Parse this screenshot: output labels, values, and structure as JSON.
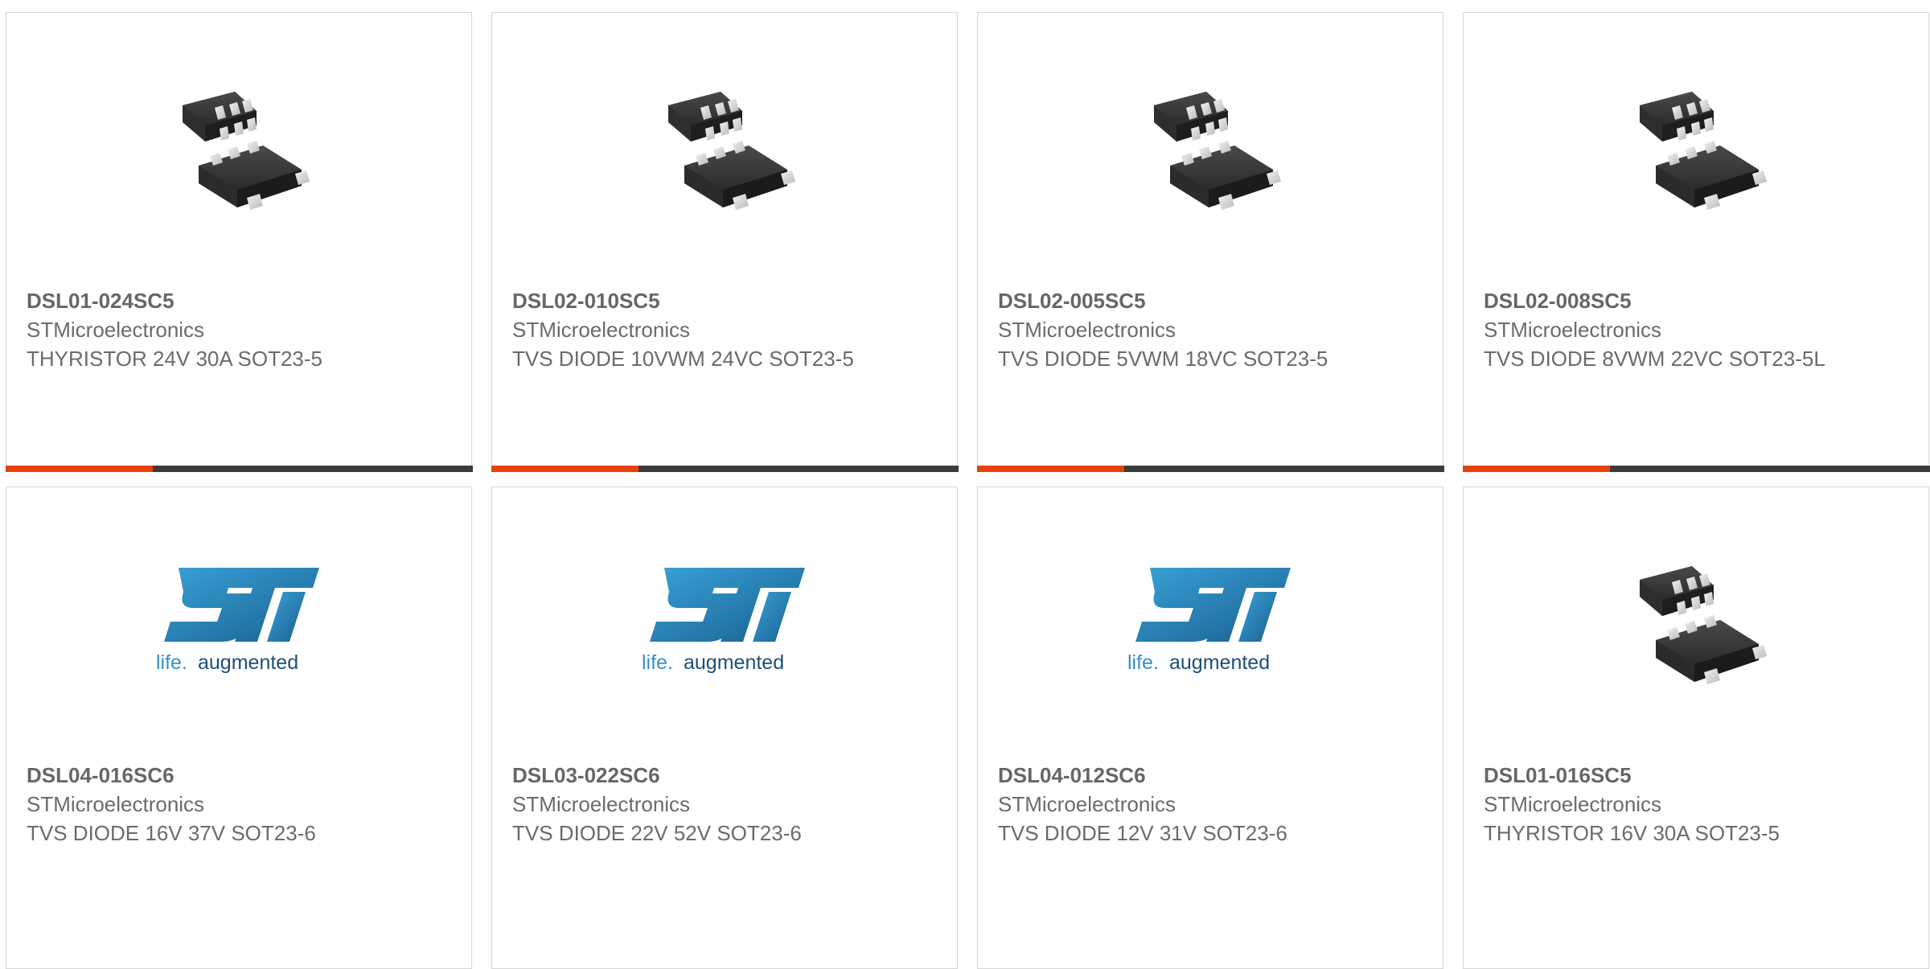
{
  "colors": {
    "accent": "#e8410f",
    "bar_track": "#3b3b3b",
    "border": "#d6d6d6",
    "text": "#6b6b6b",
    "st_logo_blue": "#1f6fa3",
    "st_tagline_blue": "#3a8fc9",
    "st_tagline_dark": "#1c4f7a"
  },
  "cards": [
    {
      "part": "DSL01-024SC5",
      "manufacturer": "STMicroelectronics",
      "description": "THYRISTOR 24V 30A SOT23-5",
      "image": "sot23-package-icon",
      "progress": 0.315
    },
    {
      "part": "DSL02-010SC5",
      "manufacturer": "STMicroelectronics",
      "description": "TVS DIODE 10VWM 24VC SOT23-5",
      "image": "sot23-package-icon",
      "progress": 0.315
    },
    {
      "part": "DSL02-005SC5",
      "manufacturer": "STMicroelectronics",
      "description": "TVS DIODE 5VWM 18VC SOT23-5",
      "image": "sot23-package-icon",
      "progress": 0.315
    },
    {
      "part": "DSL02-008SC5",
      "manufacturer": "STMicroelectronics",
      "description": "TVS DIODE 8VWM 22VC SOT23-5L",
      "image": "sot23-package-icon",
      "progress": 0.315
    },
    {
      "part": "DSL04-016SC6",
      "manufacturer": "STMicroelectronics",
      "description": "TVS DIODE 16V 37V SOT23-6",
      "image": "st-logo",
      "logo_tagline_a": "life.",
      "logo_tagline_b": "augmented"
    },
    {
      "part": "DSL03-022SC6",
      "manufacturer": "STMicroelectronics",
      "description": "TVS DIODE 22V 52V SOT23-6",
      "image": "st-logo",
      "logo_tagline_a": "life.",
      "logo_tagline_b": "augmented"
    },
    {
      "part": "DSL04-012SC6",
      "manufacturer": "STMicroelectronics",
      "description": "TVS DIODE 12V 31V SOT23-6",
      "image": "st-logo",
      "logo_tagline_a": "life.",
      "logo_tagline_b": "augmented"
    },
    {
      "part": "DSL01-016SC5",
      "manufacturer": "STMicroelectronics",
      "description": "THYRISTOR 16V 30A SOT23-5",
      "image": "sot23-package-icon"
    }
  ]
}
